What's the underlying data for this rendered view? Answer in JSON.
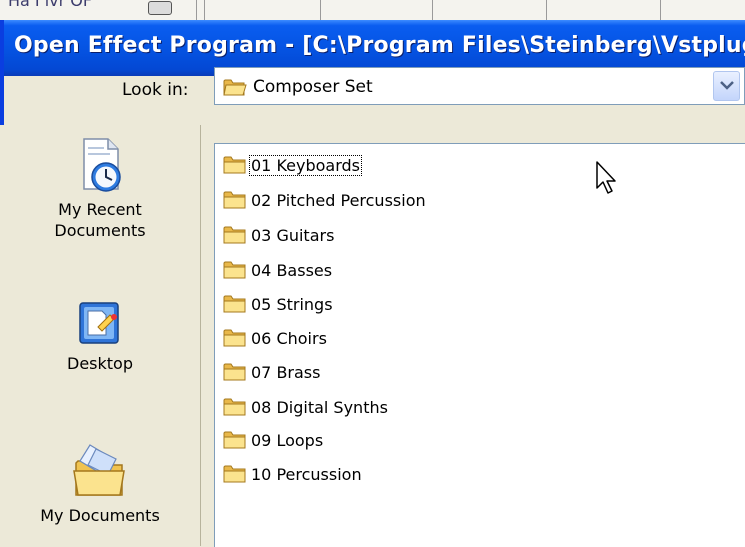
{
  "background_window": {
    "visible_text": "Ha I  ivr OF"
  },
  "dialog": {
    "title": "Open Effect Program - [C:\\Program Files\\Steinberg\\Vstplugins\\",
    "look_in_label": "Look in:",
    "look_in_value": "Composer Set"
  },
  "places": [
    {
      "label_line1": "My Recent",
      "label_line2": "Documents",
      "icon": "recent-documents-icon"
    },
    {
      "label_line1": "Desktop",
      "label_line2": "",
      "icon": "desktop-icon"
    },
    {
      "label_line1": "My Documents",
      "label_line2": "",
      "icon": "my-documents-icon"
    }
  ],
  "files": [
    {
      "name": "01 Keyboards",
      "icon": "folder-icon",
      "focused": true
    },
    {
      "name": "02 Pitched Percussion",
      "icon": "folder-icon"
    },
    {
      "name": "03 Guitars",
      "icon": "folder-icon"
    },
    {
      "name": "04 Basses",
      "icon": "folder-icon"
    },
    {
      "name": "05 Strings",
      "icon": "folder-icon"
    },
    {
      "name": "06 Choirs",
      "icon": "folder-icon"
    },
    {
      "name": "07 Brass",
      "icon": "folder-icon"
    },
    {
      "name": "08 Digital Synths",
      "icon": "folder-icon"
    },
    {
      "name": "09 Loops",
      "icon": "folder-icon"
    },
    {
      "name": "10 Percussion",
      "icon": "folder-icon"
    }
  ],
  "colors": {
    "titlebar": "#0554e3",
    "dialog_bg": "#ece9d8",
    "folder": "#f3d271"
  }
}
